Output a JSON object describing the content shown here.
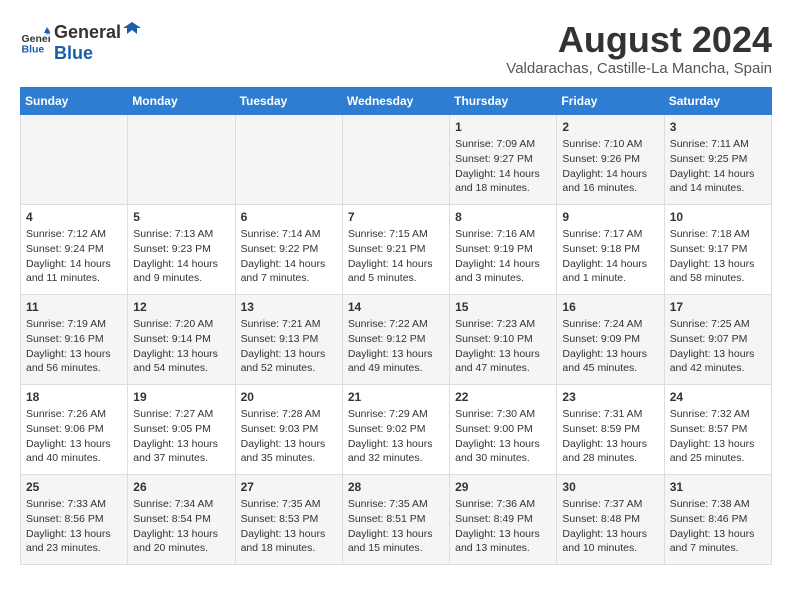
{
  "header": {
    "logo_line1": "General",
    "logo_line2": "Blue",
    "month_year": "August 2024",
    "location": "Valdarachas, Castille-La Mancha, Spain"
  },
  "weekdays": [
    "Sunday",
    "Monday",
    "Tuesday",
    "Wednesday",
    "Thursday",
    "Friday",
    "Saturday"
  ],
  "weeks": [
    [
      {
        "day": "",
        "info": ""
      },
      {
        "day": "",
        "info": ""
      },
      {
        "day": "",
        "info": ""
      },
      {
        "day": "",
        "info": ""
      },
      {
        "day": "1",
        "info": "Sunrise: 7:09 AM\nSunset: 9:27 PM\nDaylight: 14 hours\nand 18 minutes."
      },
      {
        "day": "2",
        "info": "Sunrise: 7:10 AM\nSunset: 9:26 PM\nDaylight: 14 hours\nand 16 minutes."
      },
      {
        "day": "3",
        "info": "Sunrise: 7:11 AM\nSunset: 9:25 PM\nDaylight: 14 hours\nand 14 minutes."
      }
    ],
    [
      {
        "day": "4",
        "info": "Sunrise: 7:12 AM\nSunset: 9:24 PM\nDaylight: 14 hours\nand 11 minutes."
      },
      {
        "day": "5",
        "info": "Sunrise: 7:13 AM\nSunset: 9:23 PM\nDaylight: 14 hours\nand 9 minutes."
      },
      {
        "day": "6",
        "info": "Sunrise: 7:14 AM\nSunset: 9:22 PM\nDaylight: 14 hours\nand 7 minutes."
      },
      {
        "day": "7",
        "info": "Sunrise: 7:15 AM\nSunset: 9:21 PM\nDaylight: 14 hours\nand 5 minutes."
      },
      {
        "day": "8",
        "info": "Sunrise: 7:16 AM\nSunset: 9:19 PM\nDaylight: 14 hours\nand 3 minutes."
      },
      {
        "day": "9",
        "info": "Sunrise: 7:17 AM\nSunset: 9:18 PM\nDaylight: 14 hours\nand 1 minute."
      },
      {
        "day": "10",
        "info": "Sunrise: 7:18 AM\nSunset: 9:17 PM\nDaylight: 13 hours\nand 58 minutes."
      }
    ],
    [
      {
        "day": "11",
        "info": "Sunrise: 7:19 AM\nSunset: 9:16 PM\nDaylight: 13 hours\nand 56 minutes."
      },
      {
        "day": "12",
        "info": "Sunrise: 7:20 AM\nSunset: 9:14 PM\nDaylight: 13 hours\nand 54 minutes."
      },
      {
        "day": "13",
        "info": "Sunrise: 7:21 AM\nSunset: 9:13 PM\nDaylight: 13 hours\nand 52 minutes."
      },
      {
        "day": "14",
        "info": "Sunrise: 7:22 AM\nSunset: 9:12 PM\nDaylight: 13 hours\nand 49 minutes."
      },
      {
        "day": "15",
        "info": "Sunrise: 7:23 AM\nSunset: 9:10 PM\nDaylight: 13 hours\nand 47 minutes."
      },
      {
        "day": "16",
        "info": "Sunrise: 7:24 AM\nSunset: 9:09 PM\nDaylight: 13 hours\nand 45 minutes."
      },
      {
        "day": "17",
        "info": "Sunrise: 7:25 AM\nSunset: 9:07 PM\nDaylight: 13 hours\nand 42 minutes."
      }
    ],
    [
      {
        "day": "18",
        "info": "Sunrise: 7:26 AM\nSunset: 9:06 PM\nDaylight: 13 hours\nand 40 minutes."
      },
      {
        "day": "19",
        "info": "Sunrise: 7:27 AM\nSunset: 9:05 PM\nDaylight: 13 hours\nand 37 minutes."
      },
      {
        "day": "20",
        "info": "Sunrise: 7:28 AM\nSunset: 9:03 PM\nDaylight: 13 hours\nand 35 minutes."
      },
      {
        "day": "21",
        "info": "Sunrise: 7:29 AM\nSunset: 9:02 PM\nDaylight: 13 hours\nand 32 minutes."
      },
      {
        "day": "22",
        "info": "Sunrise: 7:30 AM\nSunset: 9:00 PM\nDaylight: 13 hours\nand 30 minutes."
      },
      {
        "day": "23",
        "info": "Sunrise: 7:31 AM\nSunset: 8:59 PM\nDaylight: 13 hours\nand 28 minutes."
      },
      {
        "day": "24",
        "info": "Sunrise: 7:32 AM\nSunset: 8:57 PM\nDaylight: 13 hours\nand 25 minutes."
      }
    ],
    [
      {
        "day": "25",
        "info": "Sunrise: 7:33 AM\nSunset: 8:56 PM\nDaylight: 13 hours\nand 23 minutes."
      },
      {
        "day": "26",
        "info": "Sunrise: 7:34 AM\nSunset: 8:54 PM\nDaylight: 13 hours\nand 20 minutes."
      },
      {
        "day": "27",
        "info": "Sunrise: 7:35 AM\nSunset: 8:53 PM\nDaylight: 13 hours\nand 18 minutes."
      },
      {
        "day": "28",
        "info": "Sunrise: 7:35 AM\nSunset: 8:51 PM\nDaylight: 13 hours\nand 15 minutes."
      },
      {
        "day": "29",
        "info": "Sunrise: 7:36 AM\nSunset: 8:49 PM\nDaylight: 13 hours\nand 13 minutes."
      },
      {
        "day": "30",
        "info": "Sunrise: 7:37 AM\nSunset: 8:48 PM\nDaylight: 13 hours\nand 10 minutes."
      },
      {
        "day": "31",
        "info": "Sunrise: 7:38 AM\nSunset: 8:46 PM\nDaylight: 13 hours\nand 7 minutes."
      }
    ]
  ]
}
